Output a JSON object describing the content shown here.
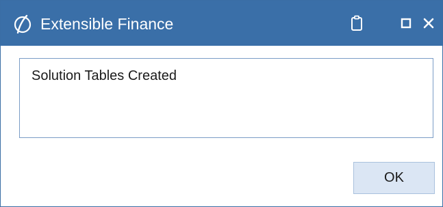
{
  "window": {
    "title": "Extensible Finance",
    "logo_icon": "app-logo-icon",
    "controls": {
      "clipboard_icon": "clipboard-icon",
      "maximize_icon": "maximize-icon",
      "close_icon": "close-icon"
    }
  },
  "message": {
    "text": "Solution Tables Created"
  },
  "buttons": {
    "ok_label": "OK"
  },
  "colors": {
    "titlebar": "#3a6fa8",
    "message_border": "#7a9cc6",
    "button_bg": "#dbe6f4",
    "button_border": "#a9c1dd"
  }
}
